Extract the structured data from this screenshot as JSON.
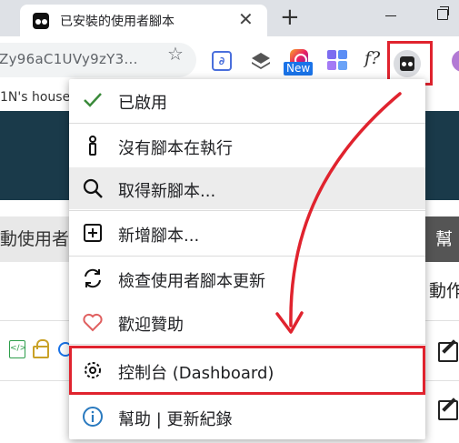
{
  "browser": {
    "tab": {
      "title": "已安裝的使用者腳本"
    },
    "address": {
      "url": "Zy96aC1UVy9zY3..."
    },
    "extensions": {
      "new_badge": "New",
      "f_label": "f?"
    }
  },
  "page": {
    "bookmark_text": "1N's house",
    "tab_active_label": "動使用者",
    "tab_right_label": "幫",
    "column_header": "動作"
  },
  "menu": {
    "items": [
      {
        "icon": "check-icon",
        "label": "已啟用"
      },
      {
        "icon": "info-i-icon",
        "label": "沒有腳本在執行"
      },
      {
        "icon": "search-icon",
        "label": "取得新腳本..."
      },
      {
        "icon": "add-box-icon",
        "label": "新增腳本..."
      },
      {
        "icon": "refresh-icon",
        "label": "檢查使用者腳本更新"
      },
      {
        "icon": "heart-icon",
        "label": "歡迎贊助"
      },
      {
        "icon": "gear-icon",
        "label": "控制台 (Dashboard)"
      },
      {
        "icon": "info-circle-icon",
        "label": "幫助 | 更新紀錄"
      }
    ]
  },
  "colors": {
    "highlight": "#e0232e",
    "check": "#3a8a3a",
    "heart": "#e06060",
    "info": "#2a7abf",
    "page_header": "#1a3a4a"
  }
}
